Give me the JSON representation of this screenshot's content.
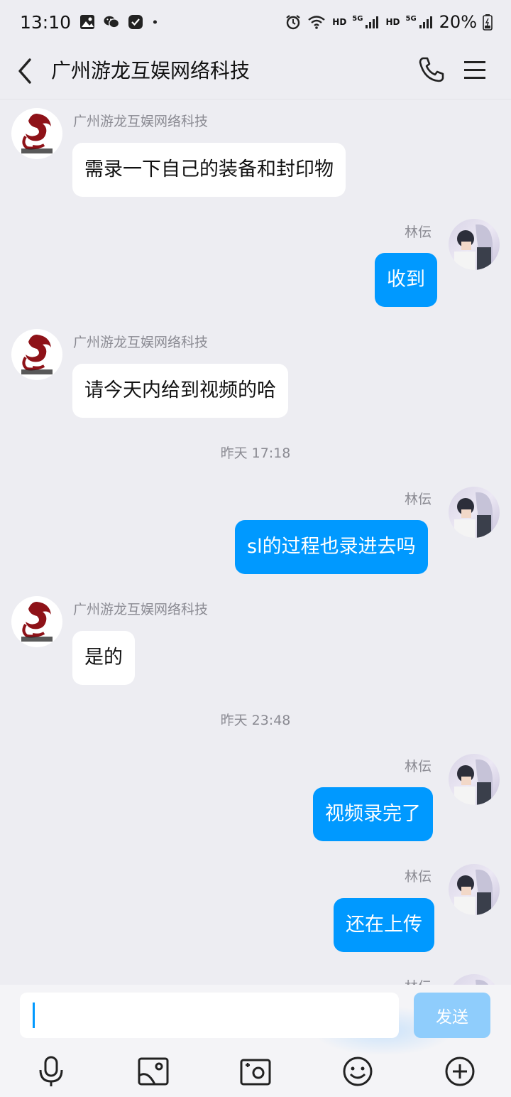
{
  "status_bar": {
    "time": "13:10",
    "battery": "20%",
    "network_1": "HD",
    "network_2": "5G",
    "network_3": "HD",
    "network_4": "5G",
    "icons": [
      "gallery-icon",
      "wechat-icon",
      "check-app-icon",
      "dot-icon",
      "alarm-icon",
      "wifi-icon",
      "signal-icon",
      "battery-icon"
    ]
  },
  "header": {
    "title": "广州游龙互娱网络科技",
    "icons": [
      "back-arrow-icon",
      "phone-icon",
      "menu-icon"
    ]
  },
  "conversation": {
    "company_name": "广州游龙互娱网络科技",
    "user_name": "林伝",
    "messages": [
      {
        "from": "company",
        "sender": "广州游龙互娱网络科技",
        "text": "需录一下自己的装备和封印物"
      },
      {
        "from": "user",
        "sender": "林伝",
        "text": "收到"
      },
      {
        "from": "company",
        "sender": "广州游龙互娱网络科技",
        "text": "请今天内给到视频的哈"
      },
      {
        "type": "timestamp",
        "text": "昨天 17:18"
      },
      {
        "from": "user",
        "sender": "林伝",
        "text": "sl的过程也录进去吗"
      },
      {
        "from": "company",
        "sender": "广州游龙互娱网络科技",
        "text": "是的"
      },
      {
        "type": "timestamp",
        "text": "昨天 23:48"
      },
      {
        "from": "user",
        "sender": "林伝",
        "text": "视频录完了"
      },
      {
        "from": "user",
        "sender": "林伝",
        "text": "还在上传"
      },
      {
        "from": "user",
        "sender": "林伝",
        "text": ""
      }
    ]
  },
  "input_bar": {
    "value": "",
    "send_label": "发送",
    "toolbar": [
      "microphone-icon",
      "image-icon",
      "camera-icon",
      "emoji-icon",
      "plus-icon"
    ]
  },
  "colors": {
    "accent": "#0099ff",
    "background": "#ededf2",
    "send_disabled": "#8fcdfc",
    "company_logo": "#8e1218"
  }
}
